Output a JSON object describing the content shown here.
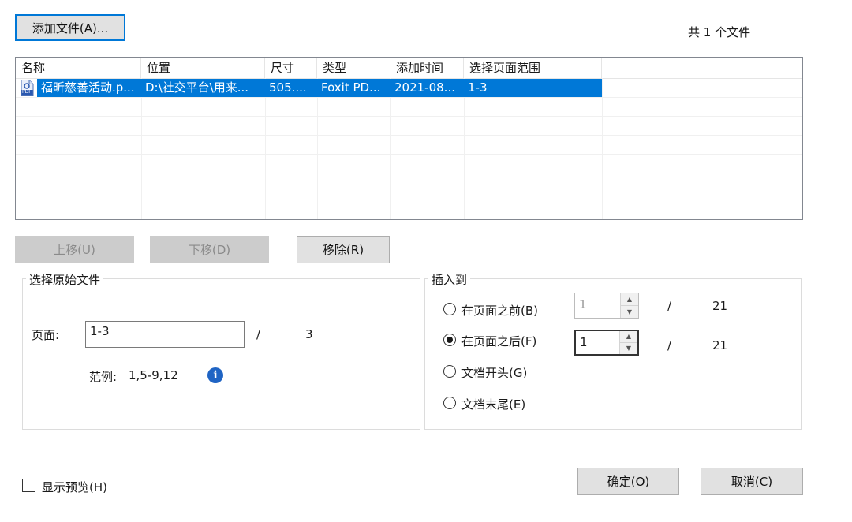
{
  "toolbar": {
    "add_file_label": "添加文件(A)...",
    "file_count_label": "共 1 个文件"
  },
  "table": {
    "columns": [
      "名称",
      "位置",
      "尺寸",
      "类型",
      "添加时间",
      "选择页面范围"
    ],
    "rows": [
      {
        "name": "福昕慈善活动.p...",
        "location": "D:\\社交平台\\用来...",
        "size": "505....",
        "type": "Foxit PD...",
        "added": "2021-08...",
        "range": "1-3",
        "icon": "pdf-file-icon",
        "icon_text": "PDF"
      }
    ]
  },
  "actions": {
    "move_up_label": "上移(U)",
    "move_down_label": "下移(D)",
    "remove_label": "移除(R)"
  },
  "source": {
    "group_title": "选择原始文件",
    "page_label": "页面:",
    "page_value": "1-3",
    "slash": "/",
    "total_pages": "3",
    "example_label": "范例:",
    "example_value": "1,5-9,12",
    "info_icon_glyph": "i"
  },
  "insert": {
    "group_title": "插入到",
    "before_label": "在页面之前(B)",
    "before_value": "1",
    "before_total": "21",
    "after_label": "在页面之后(F)",
    "after_value": "1",
    "after_total": "21",
    "start_label": "文档开头(G)",
    "end_label": "文档末尾(E)",
    "slash": "/",
    "selected": "after"
  },
  "footer": {
    "preview_label": "显示预览(H)",
    "preview_checked": false,
    "ok_label": "确定(O)",
    "cancel_label": "取消(C)"
  },
  "colors": {
    "selection": "#0078d7",
    "button_bg": "#e1e1e1",
    "info_icon": "#1f64c4"
  }
}
